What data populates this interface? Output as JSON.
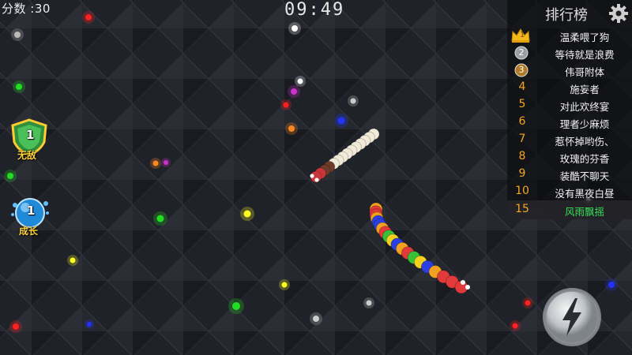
{
  "hud": {
    "score_text": "分数 :30",
    "timer": "09:49"
  },
  "leaderboard": {
    "title": "排行榜",
    "entries": [
      {
        "rank": "1",
        "name": "温柔喂了狗",
        "icon": "crown-icon"
      },
      {
        "rank": "2",
        "name": "等待就是浪费",
        "icon": "silver-medal-icon"
      },
      {
        "rank": "3",
        "name": "伟哥附体",
        "icon": "bronze-medal-icon"
      },
      {
        "rank": "4",
        "name": "施妄者"
      },
      {
        "rank": "5",
        "name": "对此欢终宴"
      },
      {
        "rank": "6",
        "name": "理者少麻烦"
      },
      {
        "rank": "7",
        "name": "惹怀掉哟伤、"
      },
      {
        "rank": "8",
        "name": "玫瑰的芬香"
      },
      {
        "rank": "9",
        "name": "装酷不聊天"
      },
      {
        "rank": "10",
        "name": "没有黑夜白昼"
      }
    ],
    "my_rank": "15",
    "my_name": "风雨飘摇"
  },
  "powerups": {
    "shield_count": "1",
    "shield_label": "无敌",
    "grow_count": "1",
    "grow_label": "成长"
  },
  "colors": {
    "rank_orange": "#f3a623",
    "my_name_green": "#38e05a",
    "board_bg": "#1c1e24"
  }
}
